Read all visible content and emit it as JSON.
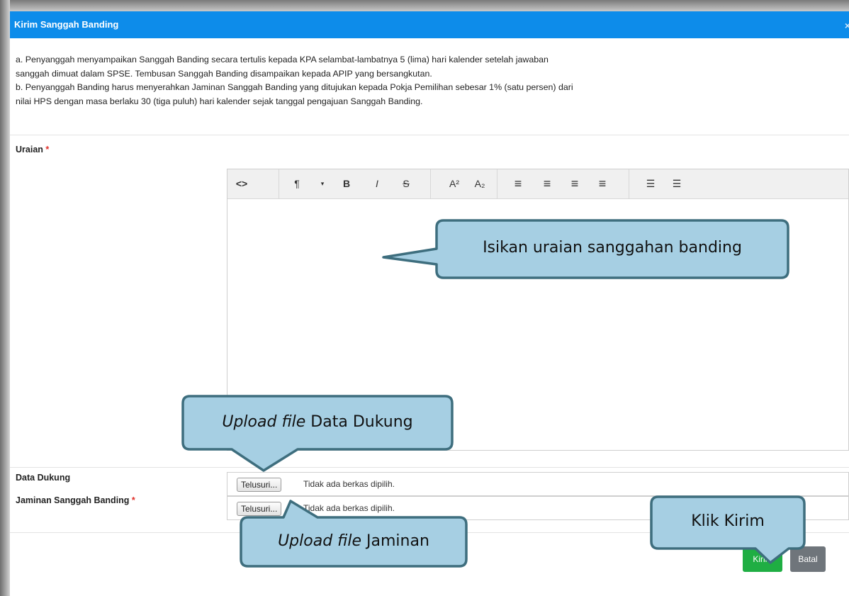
{
  "dialog": {
    "title": "Kirim Sanggah Banding",
    "close_glyph": "×"
  },
  "info": {
    "line_a1": "a. Penyanggah menyampaikan Sanggah Banding secara tertulis kepada KPA selambat-lambatnya 5 (lima) hari kalender setelah jawaban",
    "line_a2": "sanggah dimuat dalam SPSE. Tembusan Sanggah Banding disampaikan kepada APIP yang bersangkutan.",
    "line_b1": "b. Penyanggah Banding harus menyerahkan Jaminan Sanggah Banding yang ditujukan kepada Pokja Pemilihan sebesar 1% (satu persen) dari",
    "line_b2": "nilai HPS dengan masa berlaku 30 (tiga puluh) hari kalender sejak tanggal pengajuan Sanggah Banding."
  },
  "form": {
    "uraian_label": "Uraian",
    "data_dukung_label": "Data Dukung",
    "jaminan_label": "Jaminan Sanggah Banding",
    "required_mark": "*",
    "browse_label": "Telusuri...",
    "no_file_text": "Tidak ada berkas dipilih."
  },
  "toolbar": {
    "code": "<>",
    "paragraph": "¶",
    "bold": "B",
    "italic": "I",
    "strike": "S",
    "superscript": "A²",
    "subscript": "A₂",
    "align_left": "≡",
    "align_center": "≡",
    "align_right": "≡",
    "justify": "≡",
    "bullet_list": "☰",
    "numbered_list": "☰",
    "icons": [
      "code-view-icon",
      "paragraph-icon",
      "bold-icon",
      "italic-icon",
      "strikethrough-icon",
      "superscript-icon",
      "subscript-icon",
      "align-left-icon",
      "align-center-icon",
      "align-right-icon",
      "align-justify-icon",
      "bullet-list-icon",
      "numbered-list-icon"
    ]
  },
  "buttons": {
    "submit": "Kirim",
    "cancel": "Batal"
  },
  "callouts": {
    "uraian": "Isikan uraian sanggahan banding",
    "data_dukung_italic": "Upload file",
    "data_dukung_rest": " Data Dukung",
    "jaminan_italic": "Upload file",
    "jaminan_rest": " Jaminan",
    "kirim": "Klik Kirim"
  },
  "colors": {
    "header": "#0d8cea",
    "submit": "#1fae43",
    "cancel": "#6f757b",
    "callout_fill": "#a6cfe3",
    "callout_stroke": "#3e6e7e",
    "required": "#e0302a"
  }
}
